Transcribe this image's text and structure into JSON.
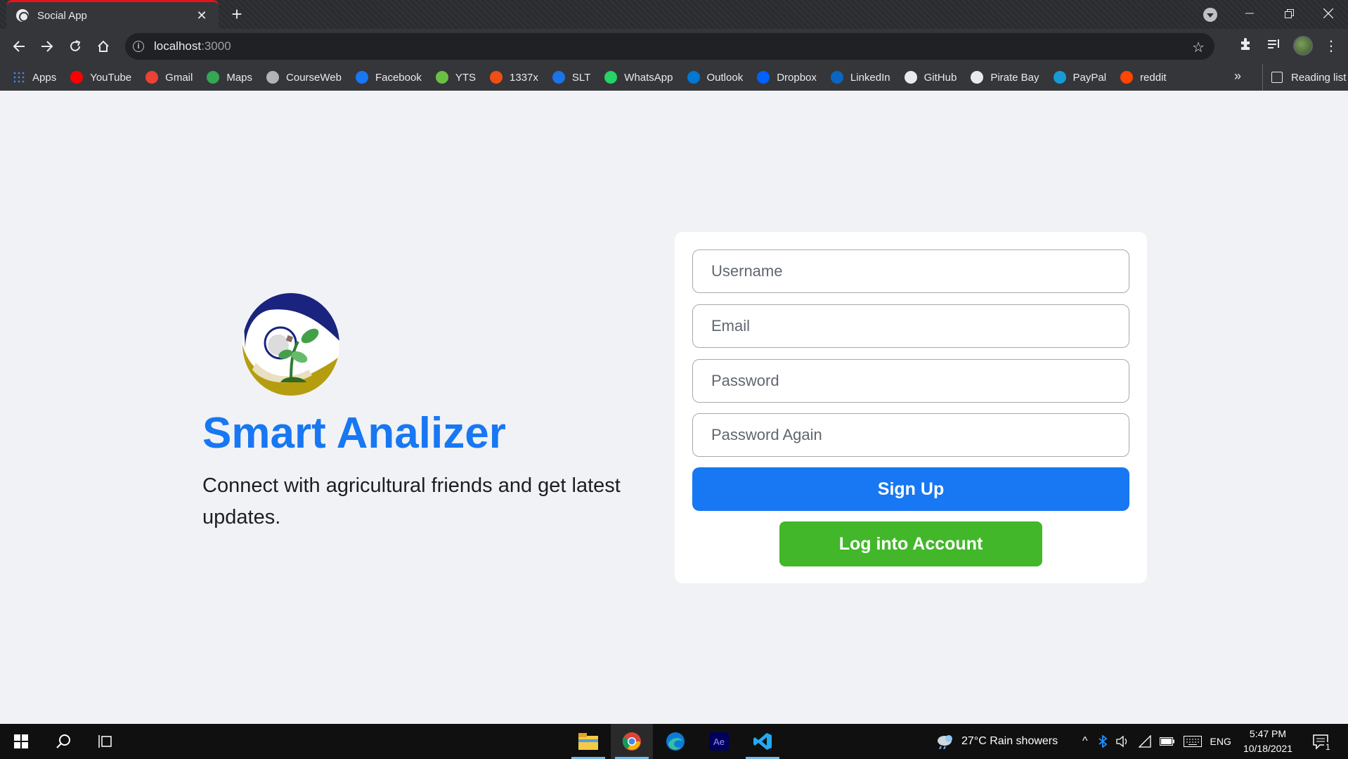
{
  "browser": {
    "tab_title": "Social App",
    "close_glyph": "✕",
    "new_tab_glyph": "+",
    "url_host": "localhost",
    "url_port": ":3000",
    "bookmarks": [
      {
        "label": "Apps",
        "icon": "apps-grid-icon",
        "color": "#4285f4"
      },
      {
        "label": "YouTube",
        "icon": "youtube-icon",
        "color": "#ff0000"
      },
      {
        "label": "Gmail",
        "icon": "gmail-icon",
        "color": "#ea4335"
      },
      {
        "label": "Maps",
        "icon": "maps-icon",
        "color": "#34a853"
      },
      {
        "label": "CourseWeb",
        "icon": "courseweb-icon",
        "color": "#b0b4ba"
      },
      {
        "label": "Facebook",
        "icon": "facebook-icon",
        "color": "#1877f2"
      },
      {
        "label": "YTS",
        "icon": "yts-icon",
        "color": "#6ac045"
      },
      {
        "label": "1337x",
        "icon": "1337x-icon",
        "color": "#f14e13"
      },
      {
        "label": "SLT",
        "icon": "slt-icon",
        "color": "#1a73e8"
      },
      {
        "label": "WhatsApp",
        "icon": "whatsapp-icon",
        "color": "#25d366"
      },
      {
        "label": "Outlook",
        "icon": "outlook-icon",
        "color": "#0078d4"
      },
      {
        "label": "Dropbox",
        "icon": "dropbox-icon",
        "color": "#0061fe"
      },
      {
        "label": "LinkedIn",
        "icon": "linkedin-icon",
        "color": "#0a66c2"
      },
      {
        "label": "GitHub",
        "icon": "github-icon",
        "color": "#e8eaed"
      },
      {
        "label": "Pirate Bay",
        "icon": "pirate-bay-icon",
        "color": "#e8eaed"
      },
      {
        "label": "PayPal",
        "icon": "paypal-icon",
        "color": "#179bd7"
      },
      {
        "label": "reddit",
        "icon": "reddit-icon",
        "color": "#ff4500"
      }
    ],
    "more_glyph": "»",
    "reading_list": "Reading list"
  },
  "page": {
    "brand": "Smart Analizer",
    "tagline": "Connect with agricultural friends and get latest updates.",
    "form": {
      "username_placeholder": "Username",
      "email_placeholder": "Email",
      "password_placeholder": "Password",
      "password_again_placeholder": "Password Again",
      "signup_label": "Sign Up",
      "login_label": "Log into Account"
    },
    "colors": {
      "primary": "#1877f2",
      "success": "#42b72a",
      "background": "#f0f2f5"
    }
  },
  "taskbar": {
    "weather": "27°C  Rain showers",
    "language": "ENG",
    "time": "5:47 PM",
    "date": "10/18/2021",
    "notification_count": "1"
  }
}
